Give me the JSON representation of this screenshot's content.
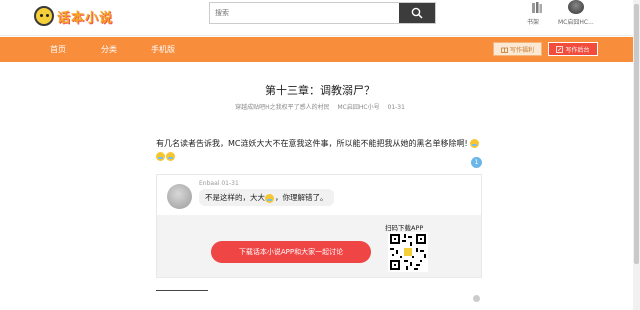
{
  "header": {
    "logo_text": "话本小说",
    "search_placeholder": "搜索",
    "shelf_label": "书架",
    "user_label": "MC启囧HC..."
  },
  "nav": {
    "items": [
      "首页",
      "分类",
      "手机版"
    ],
    "welfare_label": "写作福利",
    "author_label": "写作后台"
  },
  "chapter": {
    "title": "第十三章：调教溺尸？",
    "book": "穿越成贴吧H之我权平了感人的村民",
    "author": "MC启囧HC小号",
    "date": "01-31"
  },
  "content": {
    "paragraph": "有几名读者告诉我，MC涟妖大大不在意我这件事，所以能不能把我从她的黑名单移除啊!"
  },
  "comment_badge": "1",
  "comment": {
    "user": "Enbaal",
    "date": "01-31",
    "text_before": "不是这样的，大大",
    "text_after": "，你理解错了。"
  },
  "promo": {
    "download_label": "下载话本小说APP和大家一起讨论",
    "qr_label": "扫码下载APP"
  }
}
